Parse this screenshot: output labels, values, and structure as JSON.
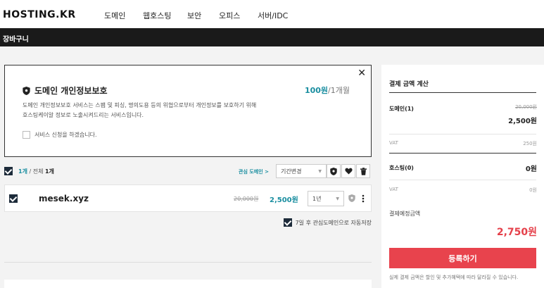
{
  "header": {
    "logo": "HOSTING.KR",
    "nav": [
      "도메인",
      "웹호스팅",
      "보안",
      "오피스",
      "서버/IDC"
    ]
  },
  "subbar": {
    "title": "장바구니"
  },
  "privacy": {
    "close": "✕",
    "title": "도메인 개인정보보호",
    "price_amount": "100원",
    "price_unit": "/1개월",
    "desc_line1": "도메인 개인정보보호 서비스는 스팸 및 피싱, 명의도용 등의 위협으로부터 개인정보를 보호하기 위해",
    "desc_line2": "호스팅케이알 정보로 노출시켜드리는 서비스입니다.",
    "agree": "서비스 신청을 하겠습니다."
  },
  "list_header": {
    "selected": "1개",
    "total_label": " / 전체 ",
    "total": "1개",
    "favorite_link": "관심 도메인 >",
    "period_select": "기간변경"
  },
  "domain_row": {
    "name": "mesek.xyz",
    "old_price": "20,000원",
    "new_price": "2,500원",
    "period": "1년"
  },
  "auto_save": "7일 후 관심도메인으로 자동저장",
  "summary": {
    "title": "결제 금액 계산",
    "domain_label": "도메인(1)",
    "domain_old": "20,000원",
    "domain_amount": "2,500원",
    "vat_label": "VAT",
    "domain_vat": "250원",
    "hosting_label": "호스팅(0)",
    "hosting_amount": "0원",
    "hosting_vat": "0원",
    "expected_label": "결제예정금액",
    "total": "2,750원",
    "register": "등록하기",
    "note": "실제 결제 금액은 할인 및 추가혜택에 따라 달라질 수 있습니다."
  },
  "colors": {
    "accent": "#1a8ea0",
    "brand_red": "#e8434d",
    "dark": "#1a1a1a"
  }
}
